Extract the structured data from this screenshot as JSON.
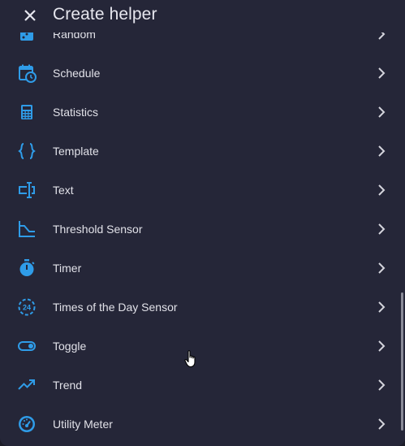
{
  "header": {
    "title": "Create helper",
    "close_icon": "close-icon"
  },
  "colors": {
    "background": "#252638",
    "accent": "#2f9ce8",
    "text": "#e1e1e8",
    "chevron": "#d4d4dc"
  },
  "items": [
    {
      "label": "Random",
      "icon": "dice-icon"
    },
    {
      "label": "Schedule",
      "icon": "calendar-clock-icon"
    },
    {
      "label": "Statistics",
      "icon": "calculator-icon"
    },
    {
      "label": "Template",
      "icon": "code-braces-icon"
    },
    {
      "label": "Text",
      "icon": "text-cursor-icon"
    },
    {
      "label": "Threshold Sensor",
      "icon": "threshold-chart-icon"
    },
    {
      "label": "Timer",
      "icon": "timer-icon"
    },
    {
      "label": "Times of the Day Sensor",
      "icon": "hours-24-icon"
    },
    {
      "label": "Toggle",
      "icon": "toggle-switch-icon"
    },
    {
      "label": "Trend",
      "icon": "trending-up-icon"
    },
    {
      "label": "Utility Meter",
      "icon": "gauge-icon"
    }
  ]
}
